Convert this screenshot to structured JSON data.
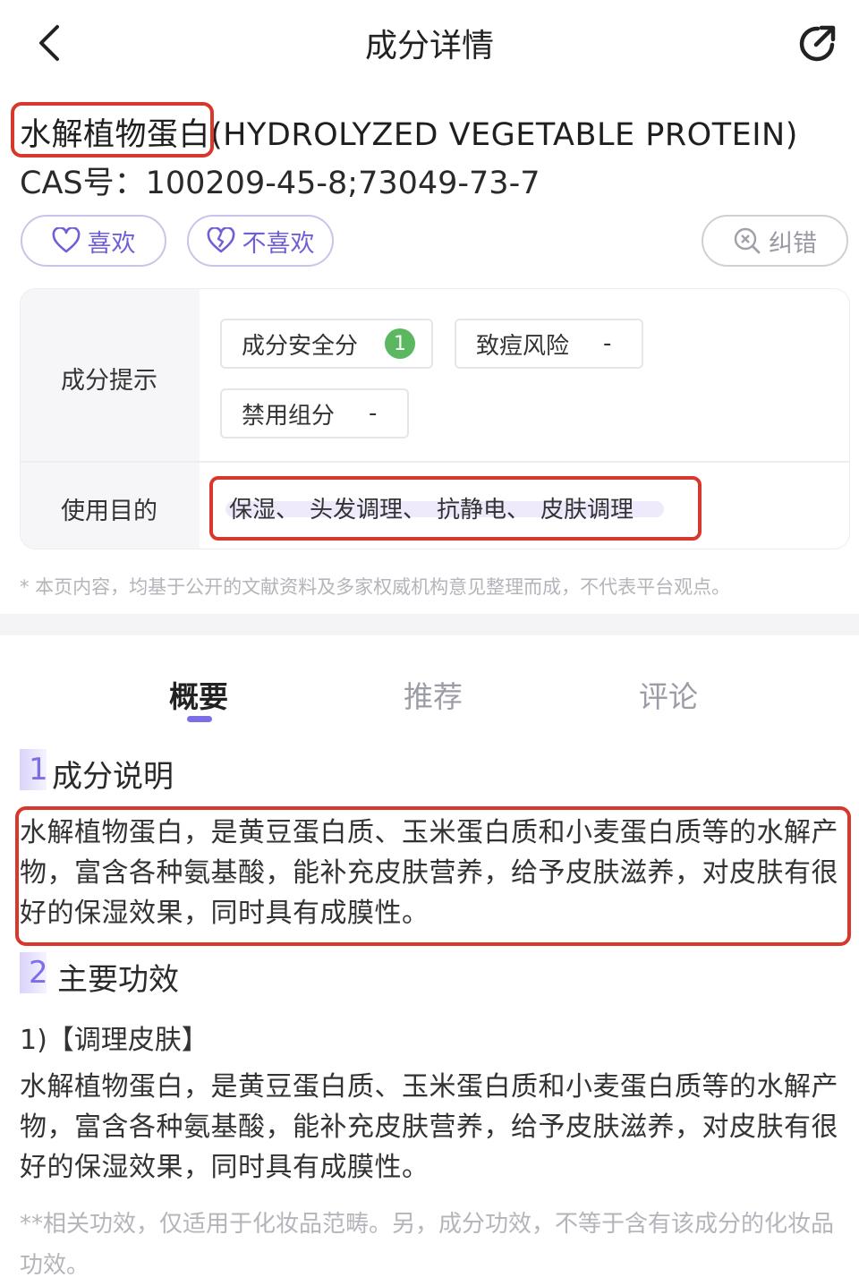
{
  "nav": {
    "title": "成分详情",
    "back_icon": "chevron-left-icon",
    "share_icon": "share-icon"
  },
  "ingredient": {
    "name_cn": "水解植物蛋白",
    "name_en": "(HYDROLYZED VEGETABLE PROTEIN)",
    "cas_label": "CAS号：",
    "cas_value": "100209-45-8;73049-73-7"
  },
  "actions": {
    "like_label": "喜欢",
    "dislike_label": "不喜欢",
    "correct_label": "纠错"
  },
  "card": {
    "hint_label": "成分提示",
    "safety_label": "成分安全分",
    "safety_score": "1",
    "acne_label": "致痘风险",
    "acne_value": "-",
    "banned_label": "禁用组分",
    "banned_value": "-",
    "purpose_label": "使用目的",
    "purposes": [
      "保湿、",
      "头发调理、",
      "抗静电、",
      "皮肤调理"
    ]
  },
  "disclaimer": "* 本页内容，均基于公开的文献资料及多家权威机构意见整理而成，不代表平台观点。",
  "tabs": [
    {
      "label": "概要",
      "active": true
    },
    {
      "label": "推荐",
      "active": false
    },
    {
      "label": "评论",
      "active": false
    }
  ],
  "section1": {
    "num": "1",
    "title": "成分说明",
    "text": "水解植物蛋白，是黄豆蛋白质、玉米蛋白质和小麦蛋白质等的水解产物，富含各种氨基酸，能补充皮肤营养，给予皮肤滋养，对皮肤有很好的保湿效果，同时具有成膜性。"
  },
  "section2": {
    "num": "2",
    "title": "主要功效",
    "subhead": "1)【调理皮肤】",
    "text": "水解植物蛋白，是黄豆蛋白质、玉米蛋白质和小麦蛋白质等的水解产物，富含各种氨基酸，能补充皮肤营养，给予皮肤滋养，对皮肤有很好的保湿效果，同时具有成膜性。",
    "note": "**相关功效，仅适用于化妆品范畴。另，成分功效，不等于含有该成分的化妆品功效。"
  },
  "colors": {
    "accent": "#7c6ee6",
    "highlight_box": "#d8372b",
    "safety_badge": "#5cb860"
  }
}
